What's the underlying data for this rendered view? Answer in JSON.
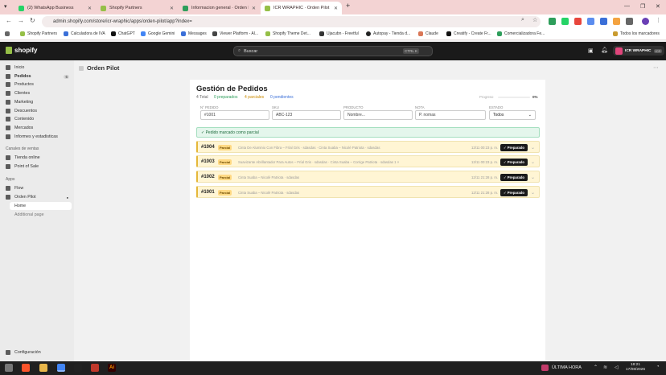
{
  "browser": {
    "tabs": [
      {
        "label": "(2) WhatsApp Business",
        "icon_color": "#25d366"
      },
      {
        "label": "Shopify Partners",
        "icon_color": "#95bf47"
      },
      {
        "label": "Informacion general · Orden P",
        "icon_color": "#2e9e5b"
      },
      {
        "label": "ICR WRAPHIC · Orden Pilot · Sh",
        "icon_color": "#95bf47"
      }
    ],
    "url": "admin.shopify.com/store/icr-wraphic/apps/orden-pilot/app?index=",
    "bookmarks": [
      "Shopify Partners",
      "Calculadora de IVA",
      "ChatGPT",
      "Google Gemini",
      "Messages",
      "Viewer Platform - Al...",
      "Shopify Theme Det...",
      "Ujacubn - Freetful",
      "Autopay - Tienda d...",
      "Claude",
      "Creatify - Create Fr...",
      "Comercializadora Fe..."
    ],
    "all_bookmarks": "Todos los marcadores"
  },
  "shopify": {
    "logo": "shopify",
    "search_placeholder": "Buscar",
    "search_shortcut": "CTRL K",
    "store_name": "ICR WRAPHIC",
    "store_badge": "ICR"
  },
  "sidebar": {
    "items": [
      {
        "label": "Inicio",
        "icon": "home-icon"
      },
      {
        "label": "Pedidos",
        "icon": "orders-icon",
        "count": "6"
      },
      {
        "label": "Productos",
        "icon": "tag-icon"
      },
      {
        "label": "Clientes",
        "icon": "person-icon"
      },
      {
        "label": "Marketing",
        "icon": "target-icon"
      },
      {
        "label": "Descuentos",
        "icon": "discount-icon"
      },
      {
        "label": "Contenido",
        "icon": "content-icon"
      },
      {
        "label": "Mercados",
        "icon": "globe-icon"
      },
      {
        "label": "Informes y estadisticas",
        "icon": "chart-icon"
      }
    ],
    "channels_heading": "Canales de ventas",
    "channels": [
      {
        "label": "Tienda online",
        "icon": "store-icon"
      },
      {
        "label": "Point of Sale",
        "icon": "pos-icon"
      }
    ],
    "apps_heading": "Apps",
    "apps": [
      {
        "label": "Flow",
        "icon": "flow-icon"
      },
      {
        "label": "Orden Pilot",
        "icon": "app-icon"
      },
      {
        "label": "Home"
      },
      {
        "label": "Additional page"
      }
    ],
    "settings": "Configuración"
  },
  "app": {
    "header": "Orden Pilot",
    "title": "Gestión de Pedidos",
    "stats": [
      {
        "label": "4 Total",
        "color": "#666666"
      },
      {
        "label": "0 preparados",
        "color": "#2e9e5b"
      },
      {
        "label": "4 parciales",
        "color": "#c98a00"
      },
      {
        "label": "0 pendientes",
        "color": "#3a6fd8"
      }
    ],
    "progress_label": "Progreso",
    "progress_pct": "0%",
    "filters": [
      {
        "label": "N° PEDIDO",
        "placeholder": "#1001"
      },
      {
        "label": "SKU",
        "placeholder": "ABC-123"
      },
      {
        "label": "PRODUCTO",
        "placeholder": "Nombre..."
      },
      {
        "label": "NOTA",
        "placeholder": "P. nomas"
      },
      {
        "label": "ESTADO",
        "value": "Todos"
      }
    ],
    "notice": "✓ Pedido marcado como parcial",
    "orders": [
      {
        "number": "#1004",
        "badge": "Parcial",
        "desc": "Cinta De Aluminio Con Fibra – Fríal Gris · sdasdas · Cinta Suaba – Nicolé Patriota · sdasdas",
        "date": "13/11 00:23 p. m.",
        "button": "✓ Preparado"
      },
      {
        "number": "#1003",
        "badge": "Parcial",
        "desc": "Suavizante Abrillantador Para Autos – Fríal Gris · sdasdas · Cinta Suaba – Corrige Patriota · sdasdas 1 ×",
        "date": "13/11 00:23 p. m.",
        "button": "✓ Preparado"
      },
      {
        "number": "#1002",
        "badge": "Parcial",
        "desc": "Cinta Suaba – Nicolé Patriota · sdasdas",
        "date": "12/11 21:28 p. m.",
        "button": "✓ Preparado"
      },
      {
        "number": "#1001",
        "badge": "Parcial",
        "desc": "Cinta Suaba – Nicolé Patriota · sdasdas",
        "date": "12/11 21:28 p. m.",
        "button": "✓ Preparado"
      }
    ]
  },
  "taskbar": {
    "news": "ÚLTIMA HORA",
    "time": "18:21",
    "date": "17/08/2026"
  }
}
